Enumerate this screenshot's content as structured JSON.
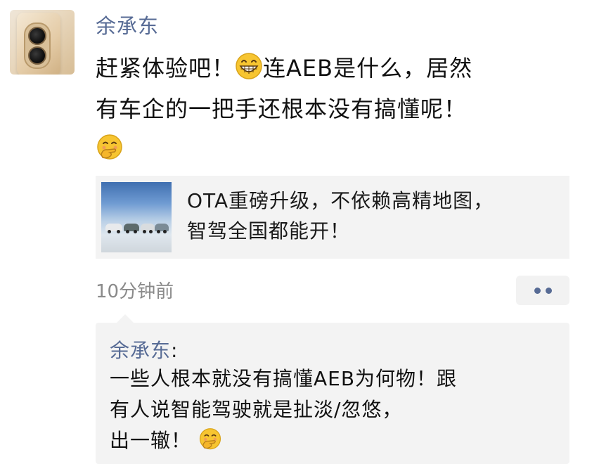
{
  "post": {
    "username": "余承东",
    "text_line1_part1": "赶紧体验吧！",
    "text_line1_part2": "连AEB是什么，居然",
    "text_line2": "有车企的一把手还根本没有搞懂呢！",
    "emoji_grin": "grinning-face-emoji",
    "emoji_hand_over_mouth": "face-with-hand-over-mouth-emoji"
  },
  "link_card": {
    "title_line1": "OTA重磅升级，不依赖高精地图，",
    "title_line2": "智驾全国都能开！",
    "thumbnail": "cars-on-road-thumbnail"
  },
  "meta": {
    "time": "10分钟前",
    "more_icon": "more-dots-icon"
  },
  "comment": {
    "author": "余承东",
    "colon": ":",
    "line1": "一些人根本就没有搞懂AEB为何物！跟",
    "line2": "有人说智能驾驶就是扯淡/忽悠，",
    "line3": "出一辙！",
    "emoji": "face-with-hand-over-mouth-emoji"
  },
  "colors": {
    "link_blue": "#576b95",
    "card_bg": "#f3f3f3",
    "time_gray": "#8a8a8a"
  }
}
